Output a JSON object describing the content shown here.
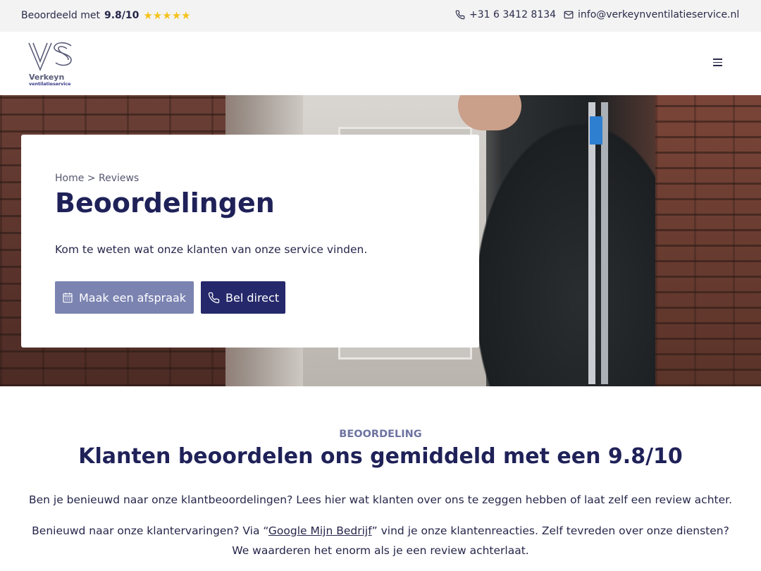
{
  "topbar": {
    "rating_prefix": "Beoordeeld met",
    "rating_score": "9.8/10",
    "stars": "★★★★★",
    "phone": "+31 6 3412 8134",
    "email": "info@verkeynventilatieservice.nl"
  },
  "header": {
    "logo_name": "Verkeyn",
    "logo_sub": "ventilatieservice",
    "menu_icon": "hamburger-menu-icon"
  },
  "hero": {
    "breadcrumb_home": "Home",
    "breadcrumb_sep": ">",
    "breadcrumb_current": "Reviews",
    "title": "Beoordelingen",
    "lead": "Kom te weten wat onze klanten van onze service vinden.",
    "btn_appointment": "Maak een afspraak",
    "btn_call": "Bel direct"
  },
  "section": {
    "eyebrow": "BEOORDELING",
    "title": "Klanten beoordelen ons gemiddeld met een 9.8/10",
    "p1": "Ben je benieuwd naar onze klantbeoordelingen? Lees hier wat klanten over ons te zeggen hebben of laat zelf een review achter.",
    "p2_before": "Benieuwd naar onze klantervaringen? Via “",
    "p2_link": "Google Mijn Bedrijf",
    "p2_after": "” vind je onze klantenreacties. Zelf tevreden over onze diensten?",
    "p2_line2": "We waarderen het enorm als je een review achterlaat."
  },
  "colors": {
    "brand_dark": "#25286a",
    "brand_light": "#7b83b1",
    "star": "#f4c21b"
  }
}
